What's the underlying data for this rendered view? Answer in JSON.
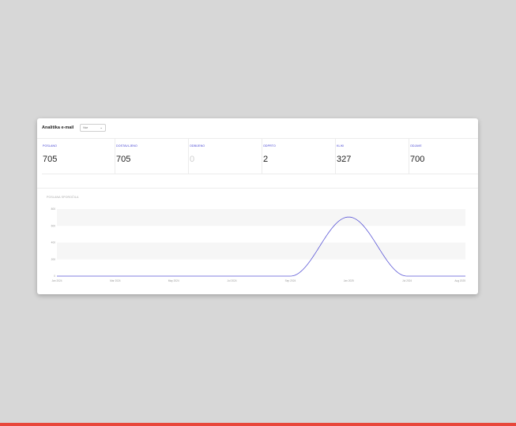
{
  "header": {
    "title": "Analitika e-mail",
    "filter_value": "Vse"
  },
  "stats": [
    {
      "label": "POSLANO",
      "value": "705"
    },
    {
      "label": "DOSTAVLJENO",
      "value": "705"
    },
    {
      "label": "ODBIJENO",
      "value": "0"
    },
    {
      "label": "ODPRTO",
      "value": "2"
    },
    {
      "label": "KLIKI",
      "value": "327"
    },
    {
      "label": "ODJAVE",
      "value": "700"
    }
  ],
  "chart_title": "POSLANA SPOROČILA",
  "chart_data": {
    "type": "area",
    "x": [
      "Jan 2024",
      "Mar 2024",
      "May 2024",
      "Jul 2024",
      "Sep 2024",
      "Jan 2025",
      "Jul 2024",
      "Aug 2025"
    ],
    "x_ticks": [
      "Jan 2024",
      "Mar 2024",
      "May 2024",
      "Jul 2024",
      "Sep 2024",
      "Jan 2025",
      "Jul 2024",
      "Aug 2025"
    ],
    "y_ticks": [
      "0",
      "200",
      "400",
      "600",
      "800"
    ],
    "ylim": [
      0,
      800
    ],
    "series": [
      {
        "values": [
          0,
          0,
          0,
          0,
          0,
          705,
          0,
          0
        ]
      }
    ],
    "line_color": "#5b57d6",
    "grid": true,
    "xlabel": "",
    "ylabel": ""
  }
}
